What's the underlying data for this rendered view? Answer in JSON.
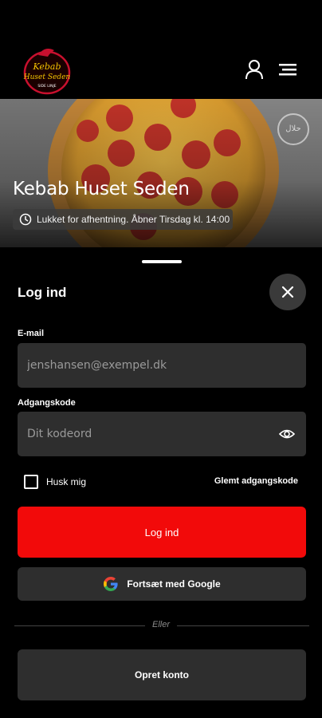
{
  "header": {
    "logo_text": [
      "Kebab",
      "Huset Seden",
      "SIDE LINJE"
    ],
    "user_icon": "person-icon",
    "menu_icon": "hamburger-icon"
  },
  "hero": {
    "restaurant_name": "Kebab Huset Seden",
    "status_text": "Lukket for afhentning. Åbner Tirsdag kl. 14:00",
    "badge_icon": "halal-icon",
    "clock_icon": "clock-icon"
  },
  "login": {
    "title": "Log ind",
    "email_label": "E-mail",
    "email_placeholder": "jenshansen@exempel.dk",
    "password_label": "Adgangskode",
    "password_placeholder": "Dit kodeord",
    "remember_label": "Husk mig",
    "forgot_label": "Glemt adgangskode",
    "login_button": "Log ind",
    "google_button": "Fortsæt med Google",
    "divider_text": "Eller",
    "create_button": "Opret konto"
  },
  "colors": {
    "accent": "#f20a0a",
    "field_bg": "#2e2e2e",
    "background": "#000000"
  }
}
